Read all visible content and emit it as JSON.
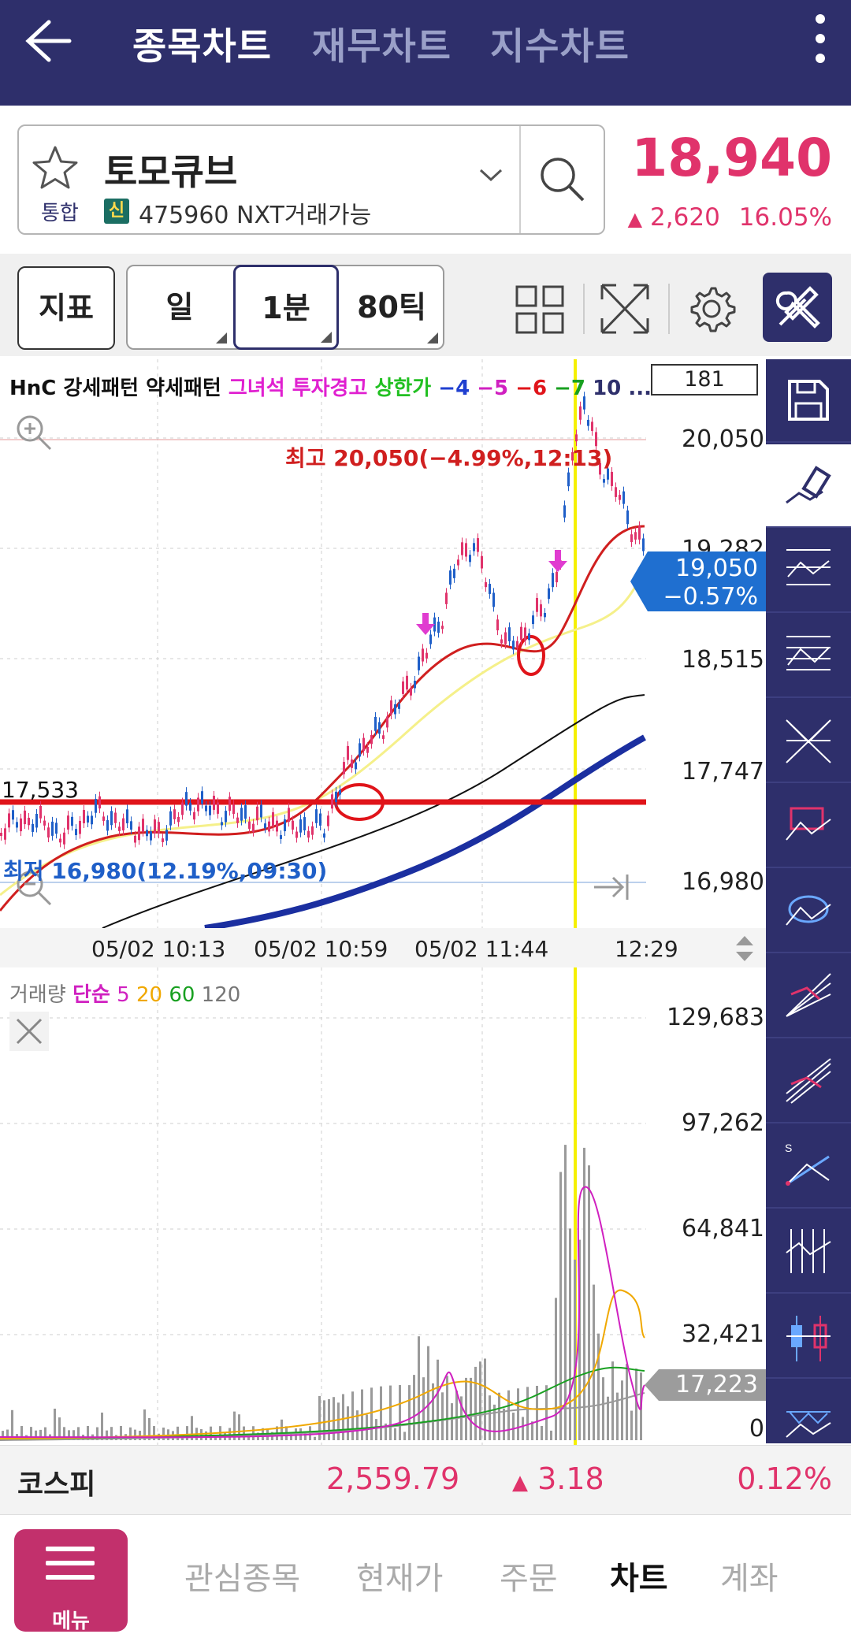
{
  "header": {
    "tabs": [
      "종목차트",
      "재무차트",
      "지수차트"
    ],
    "active_tab": 0
  },
  "stock": {
    "name": "토모큐브",
    "market": "통합",
    "credit_badge": "신",
    "code_text": "475960 NXT거래가능",
    "price": "18,940",
    "change_arrow": "▲",
    "change": "2,620",
    "change_pct": "16.05%"
  },
  "toolbar": {
    "indicator_label": "지표",
    "period_day": "일",
    "period_min": "1분",
    "period_tick": "80틱"
  },
  "chart": {
    "count": "181",
    "legend": {
      "patterns": "HnC 강세패턴 약세패턴",
      "warn": "그녀석 투자경고",
      "limit": "상한가",
      "n4": "−4",
      "n5": "−5",
      "n6": "−6",
      "n7": "−7",
      "n10": "10 ..."
    },
    "high_label": "최고 20,050(−4.99%,12:13)",
    "low_label": "최저 16,980(12.19%,09:30)",
    "support_label": "17,533",
    "y_labels": [
      "20,050",
      "19,282",
      "18,515",
      "17,747",
      "16,980"
    ],
    "last_price": "19,050",
    "last_change": "−0.57%",
    "x_labels": [
      "05/02 10:13",
      "05/02 10:59",
      "05/02 11:44",
      "12:29"
    ],
    "colors": {
      "up": "#e0336b",
      "down": "#1f5fc8",
      "ma5": "#d01f1f",
      "ma20": "#f5f08a",
      "ma60": "#111111",
      "ma120": "#1b2fa0"
    }
  },
  "volume": {
    "legend_prefix": "거래량",
    "legend_type": "단순",
    "legend_5": "5",
    "legend_20": "20",
    "legend_60": "60",
    "legend_120": "120",
    "y_labels": [
      "129,683",
      "97,262",
      "64,841",
      "32,421",
      "0"
    ],
    "current": "17,223"
  },
  "kospi": {
    "name": "코스피",
    "value": "2,559.79",
    "arrow": "▲",
    "change": "3.18",
    "pct": "0.12%"
  },
  "bottom_nav": {
    "menu": "메뉴",
    "items": [
      "관심종목",
      "현재가",
      "주문",
      "차트",
      "계좌"
    ],
    "active": 3
  }
}
